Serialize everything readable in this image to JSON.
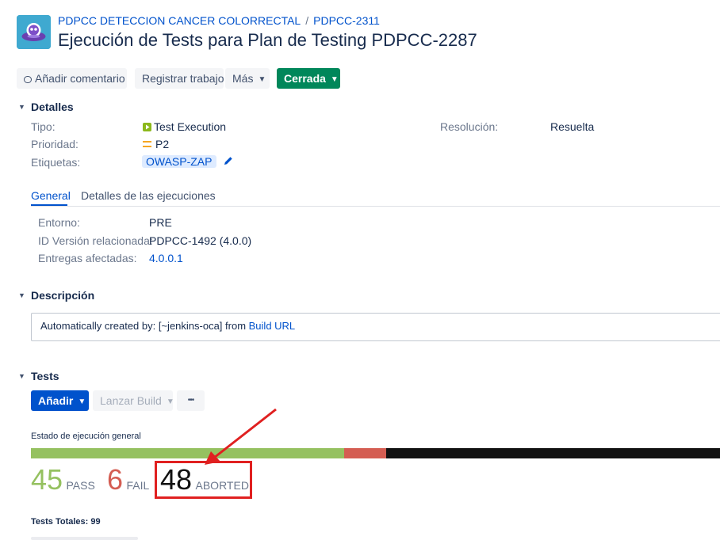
{
  "header": {
    "project_name": "PDPCC DETECCION CANCER COLORRECTAL",
    "breadcrumb_separator": "/",
    "parent_issue": "PDPCC-2311",
    "title": "Ejecución de Tests para Plan de Testing PDPCC-2287"
  },
  "toolbar": {
    "comment_label": "Añadir comentario",
    "log_work_label": "Registrar trabajo",
    "more_label": "Más",
    "status_label": "Cerrada"
  },
  "details": {
    "heading": "Detalles",
    "type_label": "Tipo:",
    "type_value": "Test Execution",
    "priority_label": "Prioridad:",
    "priority_value": "P2",
    "labels_label": "Etiquetas:",
    "labels_value": "OWASP-ZAP",
    "resolution_label": "Resolución:",
    "resolution_value": "Resuelta"
  },
  "tabs": [
    {
      "label": "General",
      "active": true
    },
    {
      "label": "Detalles de las ejecuciones",
      "active": false
    }
  ],
  "general": {
    "env_label": "Entorno:",
    "env_value": "PRE",
    "version_label": "ID Versión relacionada:",
    "version_value": "PDPCC-1492 (4.0.0)",
    "fix_label": "Entregas afectadas:",
    "fix_value": "4.0.0.1"
  },
  "description": {
    "heading": "Descripción",
    "text_prefix": "Automatically created by: [~jenkins-oca] from ",
    "link_text": "Build URL"
  },
  "tests": {
    "heading": "Tests",
    "add_label": "Añadir",
    "launch_label": "Lanzar Build",
    "more_label": "•••",
    "status_heading": "Estado de ejecución general",
    "pass_count": "45",
    "pass_label": "PASS",
    "fail_count": "6",
    "fail_label": "FAIL",
    "aborted_count": "48",
    "aborted_label": "ABORTED",
    "total_label": "Tests Totales: 99",
    "progress": {
      "pass": 45,
      "fail": 6,
      "aborted": 48
    }
  },
  "colors": {
    "pass": "#95c160",
    "fail": "#d45d52",
    "aborted": "#111111",
    "highlight": "#e02020"
  }
}
